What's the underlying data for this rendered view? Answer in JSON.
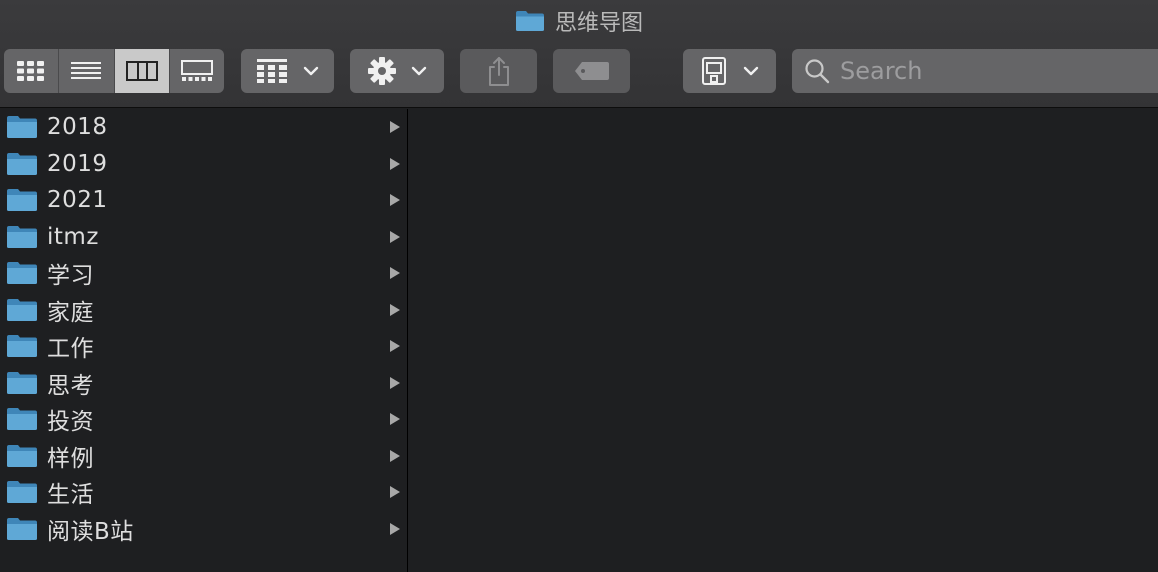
{
  "window": {
    "title": "思维导图"
  },
  "toolbar": {
    "view_modes": [
      {
        "icon": "icon-view-grid-icon",
        "active": false
      },
      {
        "icon": "list-view-icon",
        "active": false
      },
      {
        "icon": "column-view-icon",
        "active": true
      },
      {
        "icon": "gallery-view-icon",
        "active": false
      }
    ],
    "group_button_icon": "group-grid-icon",
    "action_button_icon": "gear-icon",
    "share_button_icon": "share-icon",
    "tag_button_icon": "tag-icon",
    "device_button_icon": "ios-device-icon",
    "search": {
      "placeholder": "Search",
      "value": ""
    }
  },
  "colors": {
    "folder": "#5fa8d6",
    "accent_active_segment": "#c9c9c9"
  },
  "sidebar": {
    "items": [
      {
        "label": "2018"
      },
      {
        "label": "2019"
      },
      {
        "label": "2021"
      },
      {
        "label": "itmz"
      },
      {
        "label": "学习"
      },
      {
        "label": "家庭"
      },
      {
        "label": "工作"
      },
      {
        "label": "思考"
      },
      {
        "label": "投资"
      },
      {
        "label": "样例"
      },
      {
        "label": "生活"
      },
      {
        "label": "阅读B站"
      }
    ]
  }
}
